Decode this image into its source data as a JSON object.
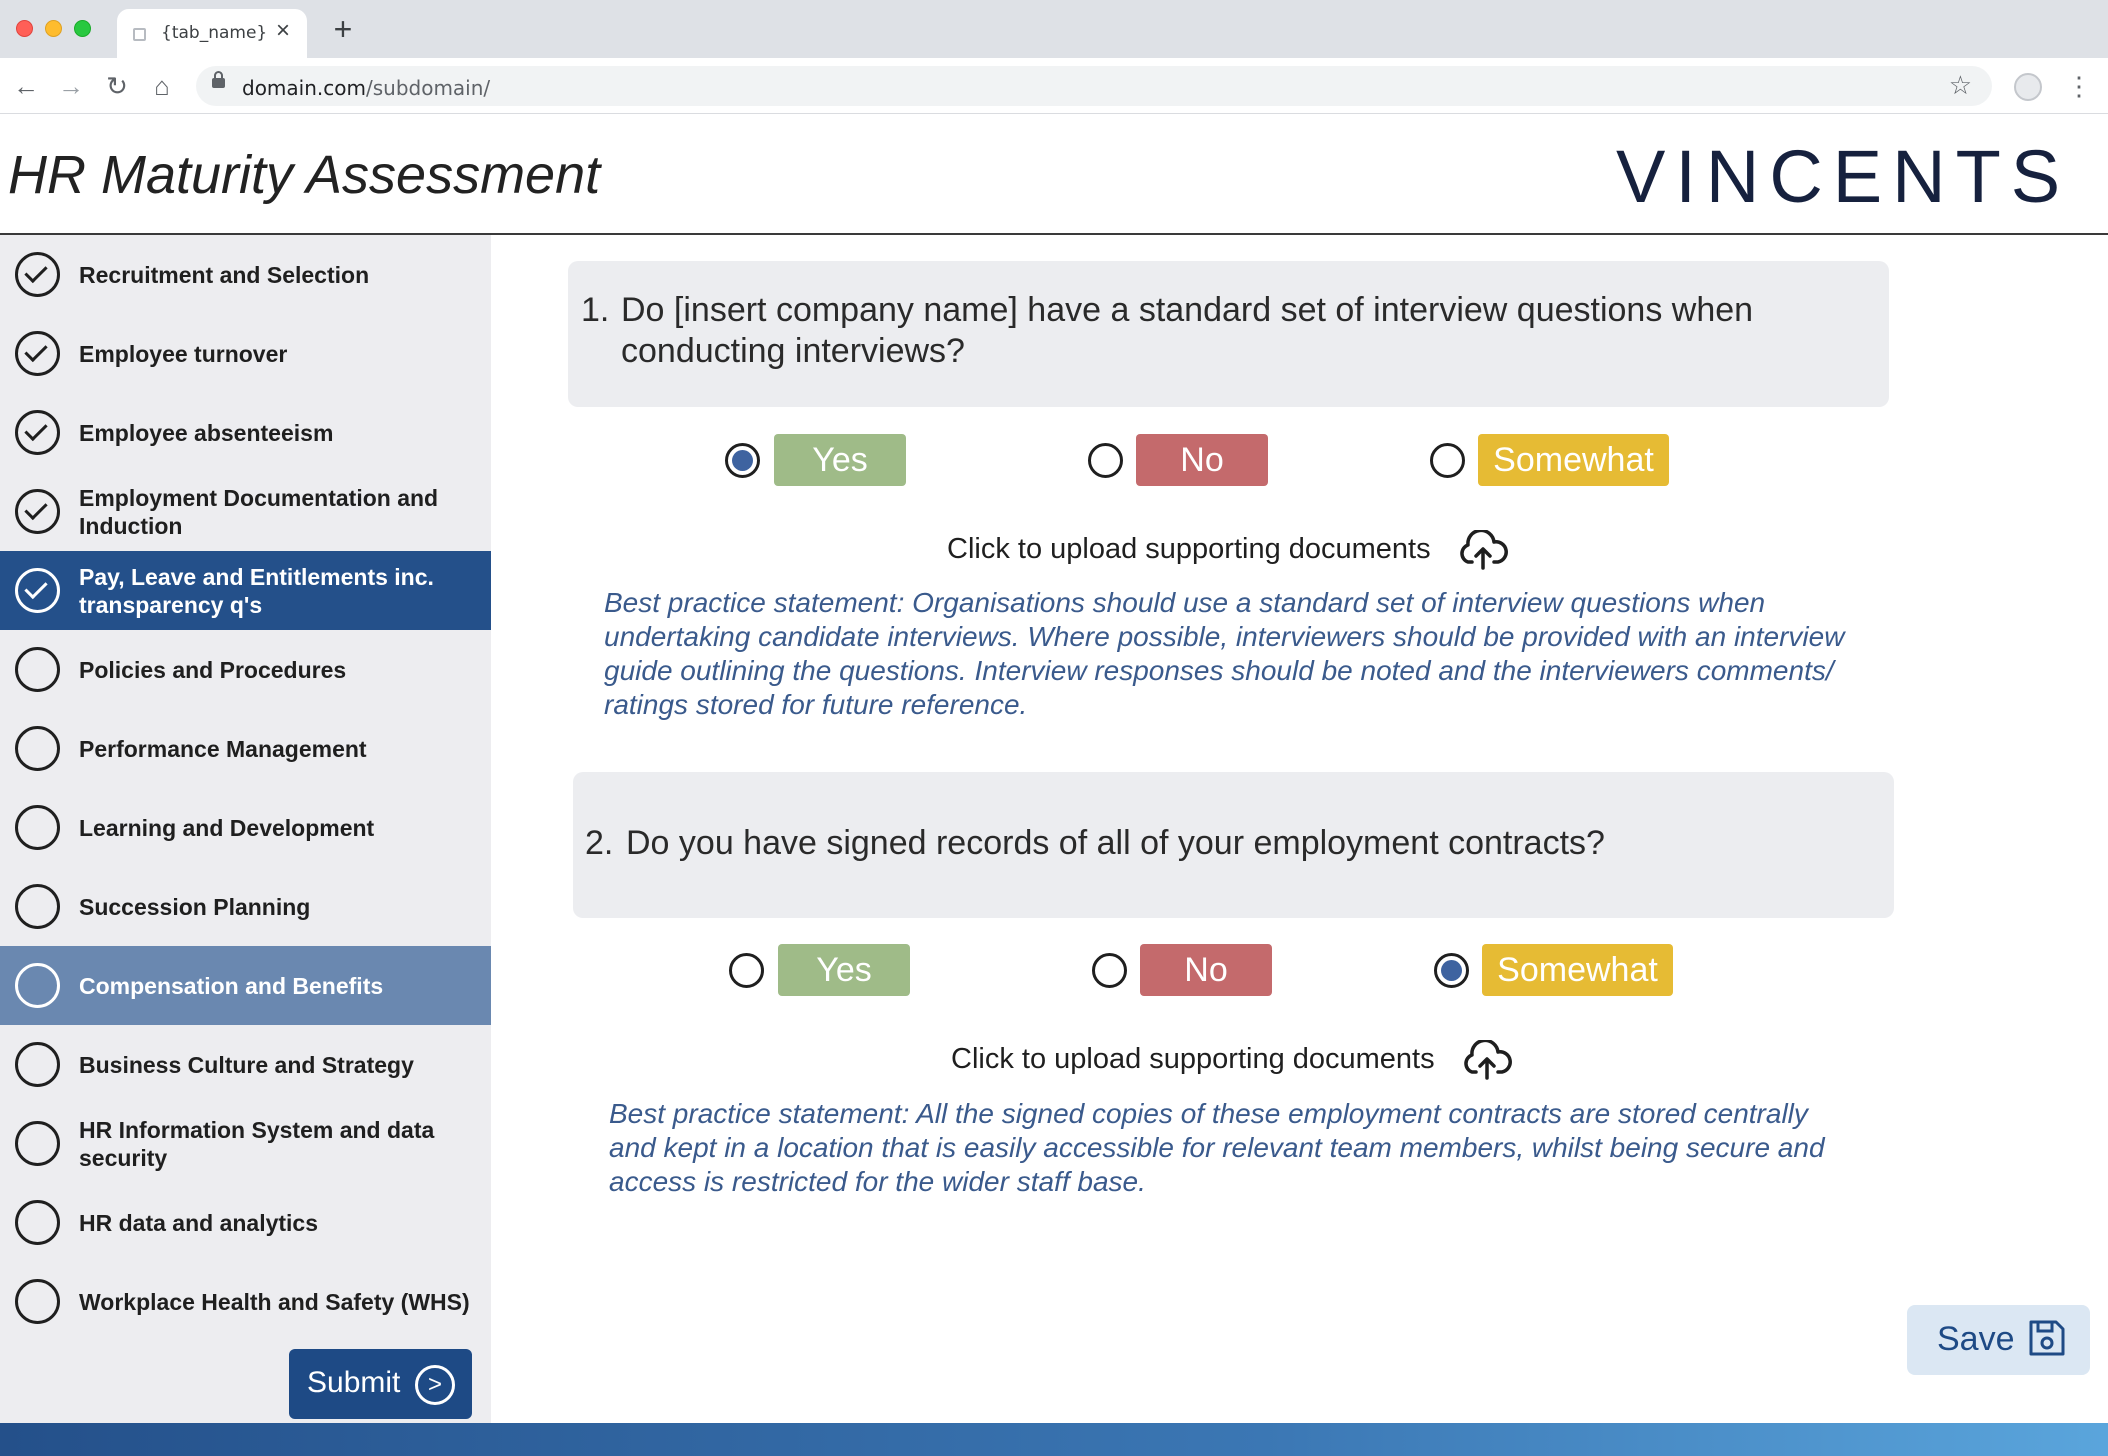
{
  "browser": {
    "tab_title": "{tab_name}",
    "url_domain": "domain.com",
    "url_path": "/subdomain/"
  },
  "header": {
    "title": "HR Maturity Assessment",
    "brand": "VINCENTS"
  },
  "sidebar": {
    "items": [
      {
        "label": "Recruitment and Selection",
        "done": true
      },
      {
        "label": "Employee turnover",
        "done": true
      },
      {
        "label": "Employee absenteeism",
        "done": true
      },
      {
        "label": "Employment Documentation and Induction",
        "done": true
      },
      {
        "label": "Pay, Leave and Entitlements inc. transparency q's",
        "done": true,
        "state": "active"
      },
      {
        "label": "Policies and Procedures",
        "done": false
      },
      {
        "label": "Performance Management",
        "done": false
      },
      {
        "label": "Learning and Development",
        "done": false
      },
      {
        "label": "Succession Planning",
        "done": false
      },
      {
        "label": "Compensation and Benefits",
        "done": false,
        "state": "hover"
      },
      {
        "label": "Business Culture and Strategy",
        "done": false
      },
      {
        "label": "HR Information System and data security",
        "done": false
      },
      {
        "label": "HR data and analytics",
        "done": false
      },
      {
        "label": "Workplace Health and Safety (WHS)",
        "done": false
      }
    ],
    "submit_label": "Submit"
  },
  "questions": [
    {
      "number": "1.",
      "text": "Do [insert company name] have a standard set of interview questions when conducting interviews?",
      "options": [
        "Yes",
        "No",
        "Somewhat"
      ],
      "selected": "Yes",
      "upload_label": "Click to upload supporting documents",
      "practice": "Best practice statement: Organisations should use a standard set of interview questions when undertaking candidate interviews. Where possible, interviewers should be provided with an interview guide outlining the questions. Interview responses should be noted and the interviewers comments/ ratings stored for future reference."
    },
    {
      "number": "2.",
      "text": "Do you have signed records of all of your employment contracts?",
      "options": [
        "Yes",
        "No",
        "Somewhat"
      ],
      "selected": "Somewhat",
      "upload_label": "Click to upload supporting documents",
      "practice": "Best practice statement: All the signed copies of these employment contracts are stored centrally and kept in a location that is easily accessible for relevant team members, whilst being secure and access is restricted for the wider staff base."
    }
  ],
  "save_label": "Save",
  "colors": {
    "primary": "#24508a",
    "yes": "#9fbb88",
    "no": "#c46a6c",
    "somewhat": "#e6bb34",
    "practice_text": "#3a5a8c"
  }
}
